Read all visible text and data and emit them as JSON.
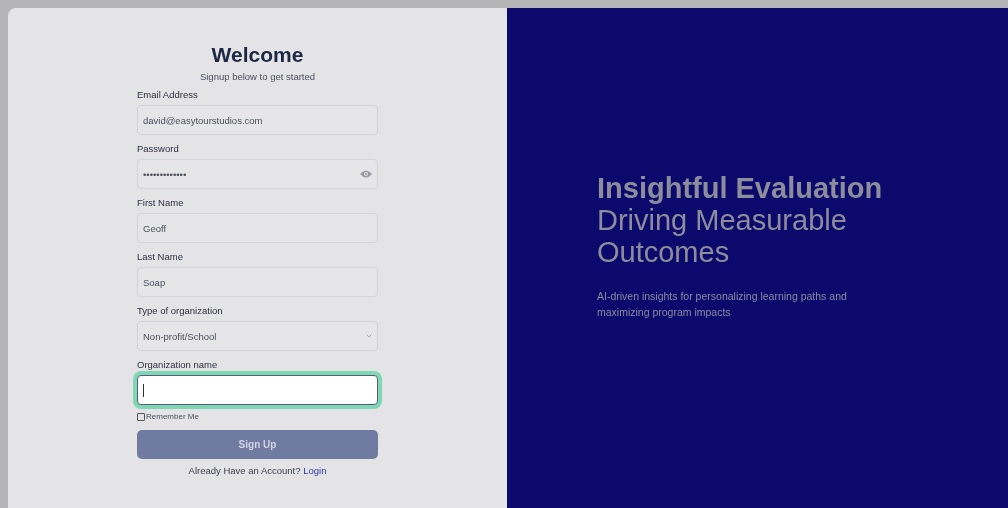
{
  "signup": {
    "title": "Welcome",
    "subtitle": "Signup below to get started",
    "fields": [
      {
        "kind": "text",
        "label": "Email Address",
        "value": "david@easytourstudios.com",
        "focused": false
      },
      {
        "kind": "password",
        "label": "Password",
        "value": "•••••••••••••",
        "focused": false
      },
      {
        "kind": "text",
        "label": "First Name",
        "value": "Geoff",
        "focused": false
      },
      {
        "kind": "text",
        "label": "Last Name",
        "value": "Soap",
        "focused": false
      },
      {
        "kind": "select",
        "label": "Type of organization",
        "value": "Non-profit/School",
        "focused": false
      },
      {
        "kind": "text",
        "label": "Organization name",
        "focused": true
      }
    ],
    "remember": {
      "label": "Remember Me",
      "checked": false
    },
    "submit": "Sign Up",
    "footer": {
      "text": "Already Have an Account?",
      "link": "Login"
    }
  },
  "hero": {
    "heading_bold": "Insightful Evaluation",
    "heading_light": "Driving Measurable Outcomes",
    "description": "AI-driven insights for personalizing learning paths and maximizing program impacts"
  }
}
